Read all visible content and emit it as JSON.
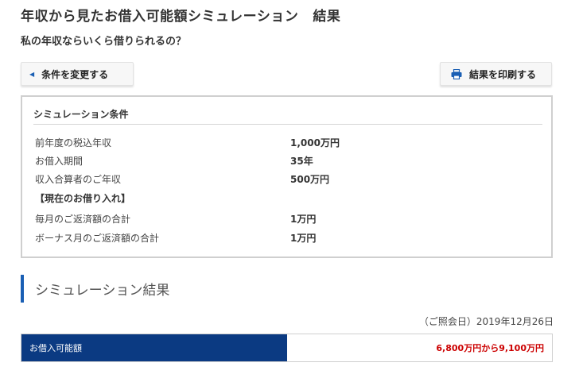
{
  "page": {
    "title": "年収から見たお借入可能額シミュレーション",
    "title_suffix": "結果",
    "subtitle": "私の年収ならいくら借りられるの？"
  },
  "buttons": {
    "change_label": "条件を変更する",
    "print_label": "結果を印刷する"
  },
  "conditions": {
    "heading": "シミュレーション条件",
    "rows": [
      {
        "label": "前年度の税込年収",
        "value": "1,000万円"
      },
      {
        "label": "お借入期間",
        "value": "35年"
      },
      {
        "label": "収入合算者のご年収",
        "value": "500万円"
      },
      {
        "label": "【現在のお借り入れ】",
        "value": ""
      },
      {
        "label": "毎月のご返済額の合計",
        "value": "1万円"
      },
      {
        "label": "ボーナス月のご返済額の合計",
        "value": "1万円"
      }
    ]
  },
  "result": {
    "heading": "シミュレーション結果",
    "date_text": "（ご照会日）2019年12月26日",
    "label": "お借入可能額",
    "value": "6,800万円から9,100万円"
  },
  "colors": {
    "accent_blue": "#1a5fb4",
    "header_navy": "#0b3a82",
    "result_red": "#cc0000"
  },
  "icons": {
    "change": "chevron-left-icon",
    "print": "printer-icon"
  }
}
